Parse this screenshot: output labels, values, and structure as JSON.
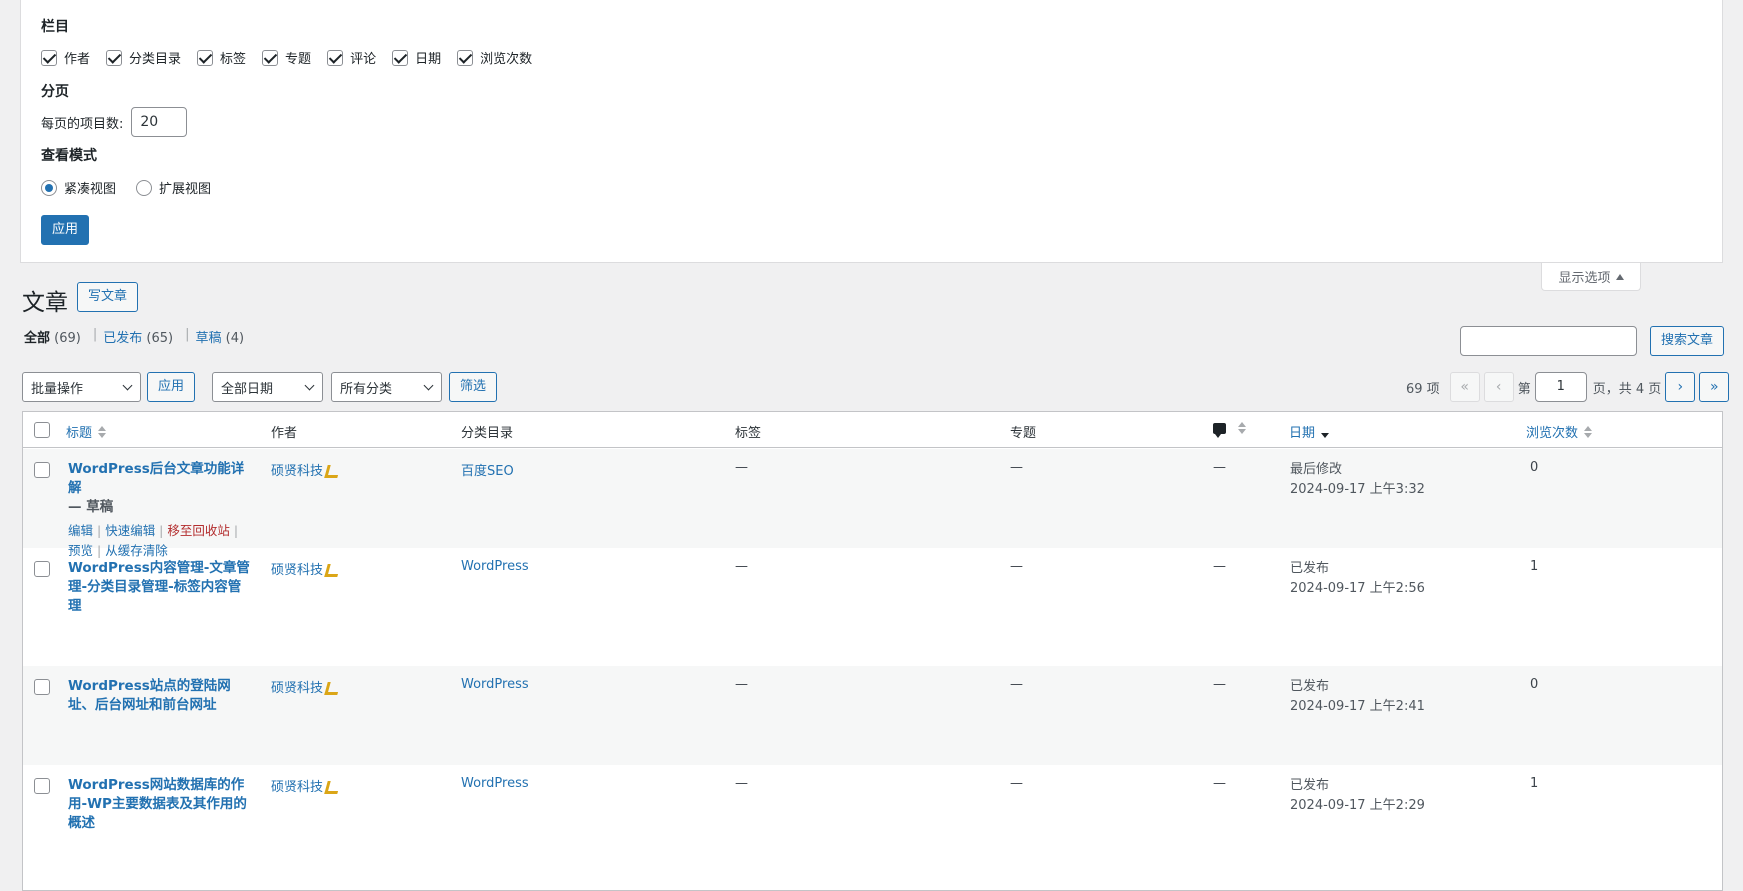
{
  "screen_options": {
    "columns_heading": "栏目",
    "columns": [
      {
        "label": "作者",
        "checked": true
      },
      {
        "label": "分类目录",
        "checked": true
      },
      {
        "label": "标签",
        "checked": true
      },
      {
        "label": "专题",
        "checked": true
      },
      {
        "label": "评论",
        "checked": true
      },
      {
        "label": "日期",
        "checked": true
      },
      {
        "label": "浏览次数",
        "checked": true
      }
    ],
    "pagination_heading": "分页",
    "per_page_label": "每页的项目数:",
    "per_page_value": "20",
    "view_mode_heading": "查看模式",
    "view_modes": [
      {
        "label": "紧凑视图",
        "selected": true
      },
      {
        "label": "扩展视图",
        "selected": false
      }
    ],
    "apply_label": "应用",
    "toggle_label": "显示选项"
  },
  "page": {
    "title": "文章",
    "add_new_label": "写文章"
  },
  "filters": {
    "all_label": "全部",
    "all_count": "(69)",
    "published_label": "已发布",
    "published_count": "(65)",
    "drafts_label": "草稿",
    "drafts_count": "(4)"
  },
  "search": {
    "button_label": "搜索文章",
    "value": ""
  },
  "tablenav": {
    "bulk_action": "批量操作",
    "apply_label": "应用",
    "date_filter": "全部日期",
    "category_filter": "所有分类",
    "filter_button": "筛选",
    "item_count": "69 项",
    "first": "«",
    "prev": "‹",
    "page_prefix": "第",
    "current_page": "1",
    "page_suffix": "页，共 4 页",
    "next": "›",
    "last": "»"
  },
  "table": {
    "headers": {
      "title": "标题",
      "author": "作者",
      "categories": "分类目录",
      "tags": "标签",
      "topics": "专题",
      "date": "日期",
      "views": "浏览次数"
    },
    "rows": [
      {
        "title": "WordPress后台文章功能详解",
        "state": "— 草稿",
        "actions": {
          "edit": "编辑",
          "quick_edit": "快速编辑",
          "trash": "移至回收站",
          "preview": "预览",
          "purge": "从缓存清除"
        },
        "author": "硕贤科技",
        "category": "百度SEO",
        "tags": "—",
        "topics": "—",
        "comments": "—",
        "date_status": "最后修改",
        "date": "2024-09-17 上午3:32",
        "views": "0"
      },
      {
        "title": "WordPress内容管理-文章管理-分类目录管理-标签内容管理",
        "state": "",
        "author": "硕贤科技",
        "category": "WordPress",
        "tags": "—",
        "topics": "—",
        "comments": "—",
        "date_status": "已发布",
        "date": "2024-09-17 上午2:56",
        "views": "1"
      },
      {
        "title": "WordPress站点的登陆网址、后台网址和前台网址",
        "state": "",
        "author": "硕贤科技",
        "category": "WordPress",
        "tags": "—",
        "topics": "—",
        "comments": "—",
        "date_status": "已发布",
        "date": "2024-09-17 上午2:41",
        "views": "0"
      },
      {
        "title": "WordPress网站数据库的作用-WP主要数据表及其作用的概述",
        "state": "",
        "author": "硕贤科技",
        "category": "WordPress",
        "tags": "—",
        "topics": "—",
        "comments": "—",
        "date_status": "已发布",
        "date": "2024-09-17 上午2:29",
        "views": "1"
      }
    ]
  }
}
